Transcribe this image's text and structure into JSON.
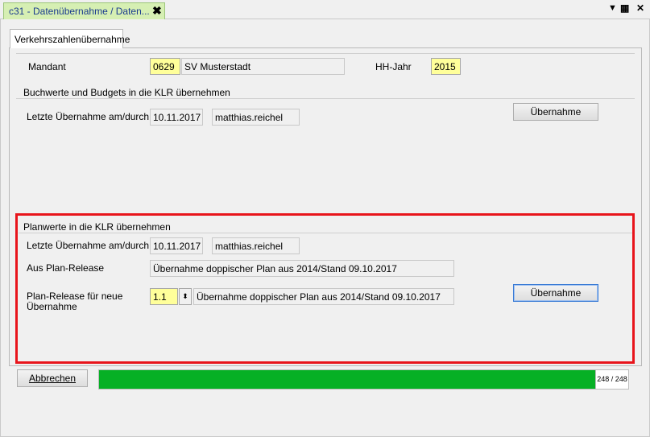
{
  "window": {
    "tab_title": "c31 - Datenübernahme / Daten...",
    "close_icon": "✖",
    "dropdown_icon": "▼",
    "layout_icon": "▦",
    "close_window_icon": "✕"
  },
  "inner_tab": {
    "label": "Verkehrszahlenübernahme"
  },
  "header": {
    "mandant_label": "Mandant",
    "mandant_code": "0629",
    "mandant_name": "SV Musterstadt",
    "hh_jahr_label": "HH-Jahr",
    "hh_jahr_value": "2015"
  },
  "section_buchwerte": {
    "title": "Buchwerte und Budgets in die KLR übernehmen",
    "last_label": "Letzte Übernahme am/durch",
    "last_date": "10.11.2017",
    "last_user": "matthias.reichel",
    "button_label": "Übernahme"
  },
  "section_planwerte": {
    "title": "Planwerte in die KLR übernehmen",
    "last_label": "Letzte Übernahme am/durch",
    "last_date": "10.11.2017",
    "last_user": "matthias.reichel",
    "aus_label": "Aus Plan-Release",
    "aus_value": "Übernahme doppischer Plan aus 2014/Stand 09.10.2017",
    "neu_label_line1": "Plan-Release für neue",
    "neu_label_line2": "Übernahme",
    "neu_code": "1.1",
    "spin_icon": "⬍",
    "neu_desc": "Übernahme doppischer Plan aus 2014/Stand 09.10.2017",
    "button_label": "Übernahme"
  },
  "footer": {
    "cancel_label": "Abbrechen",
    "progress_text": "248 / 248",
    "progress_fraction": 1.0
  },
  "colors": {
    "tab_green": "#d6efb3",
    "progress_green": "#06b025",
    "highlight_red": "#e8141b",
    "field_yellow": "#ffff9a"
  }
}
